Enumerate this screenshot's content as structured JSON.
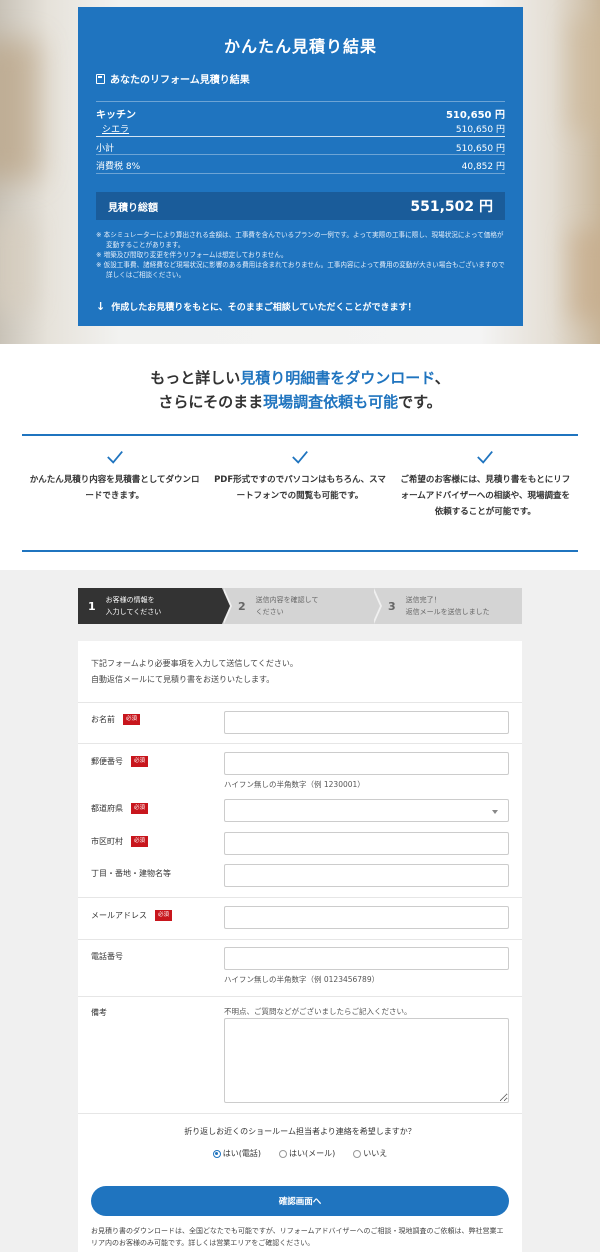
{
  "result": {
    "title": "かんたん見積り結果",
    "subtitle": "あなたのリフォーム見積り結果",
    "category": {
      "label": "キッチン",
      "price": "510,650 円"
    },
    "item": {
      "label": "シエラ",
      "price": "510,650 円"
    },
    "subtotal": {
      "label": "小計",
      "price": "510,650 円"
    },
    "tax": {
      "label": "消費税 8%",
      "price": "40,852 円"
    },
    "total": {
      "label": "見積り総額",
      "price": "551,502 円"
    },
    "notes": [
      "※ 本シミュレーターにより算出される金額は、工事費を含んでいるプランの一例です。よって実際の工事に際し、現場状況によって価格が変動することがあります。",
      "※ 増築及び間取り変更を伴うリフォームは想定しておりません。",
      "※ 仮設工事費、諸経費など現場状況に影響のある費用は含まれておりません。工事内容によって費用の変動が大きい場合もございますので詳しくはご相談ください。"
    ],
    "cta": "作成したお見積りをもとに、そのままご相談していただくことができます！"
  },
  "intro": {
    "headline_1a": "もっと詳しい",
    "headline_1b": "見積り明細書をダウンロード",
    "headline_1c": "、",
    "headline_2a": "さらにそのまま",
    "headline_2b": "現場調査依頼も可能",
    "headline_2c": "です。",
    "features": [
      "かんたん見積り内容を見積書としてダウンロードできます。",
      "PDF形式ですのでパソコンはもちろん、スマートフォンでの閲覧も可能です。",
      "ご希望のお客様には、見積り書をもとにリフォームアドバイザーへの相談や、現場調査を依頼することが可能です。"
    ]
  },
  "steps": [
    {
      "num": "1",
      "line1": "お客様の情報を",
      "line2": "入力してください"
    },
    {
      "num": "2",
      "line1": "送信内容を確認して",
      "line2": "ください"
    },
    {
      "num": "3",
      "line1": "送信完了！",
      "line2": "返信メールを送信しました"
    }
  ],
  "form": {
    "lead_1": "下記フォームより必要事項を入力して送信してください。",
    "lead_2": "自動返信メールにて見積り書をお送りいたします。",
    "required": "必須",
    "name_label": "お名前",
    "zip_label": "郵便番号",
    "zip_hint": "ハイフン無しの半角数字（例 1230001）",
    "pref_label": "都道府県",
    "city_label": "市区町村",
    "address_label": "丁目・番地・建物名等",
    "email_label": "メールアドレス",
    "tel_label": "電話番号",
    "tel_hint": "ハイフン無しの半角数字（例 0123456789）",
    "note_label": "備考",
    "note_hint": "不明点、ご質問などがございましたらご記入ください。",
    "question": "折り返しお近くのショールーム担当者より連絡を希望しますか？",
    "radio_1": "はい(電話)",
    "radio_2": "はい(メール)",
    "radio_3": "いいえ",
    "confirm": "確認画面へ",
    "footnote": "お見積り書のダウンロードは、全国どなたでも可能ですが、リフォームアドバイザーへのご相談・現地調査のご依頼は、弊社営業エリア内のお客様のみ可能です。詳しくは営業エリアをご確認ください。"
  },
  "colors": {
    "accent": "#1f74bf",
    "required": "#c8161d",
    "step_active": "#333333",
    "step_inactive": "#d4d4d4"
  }
}
